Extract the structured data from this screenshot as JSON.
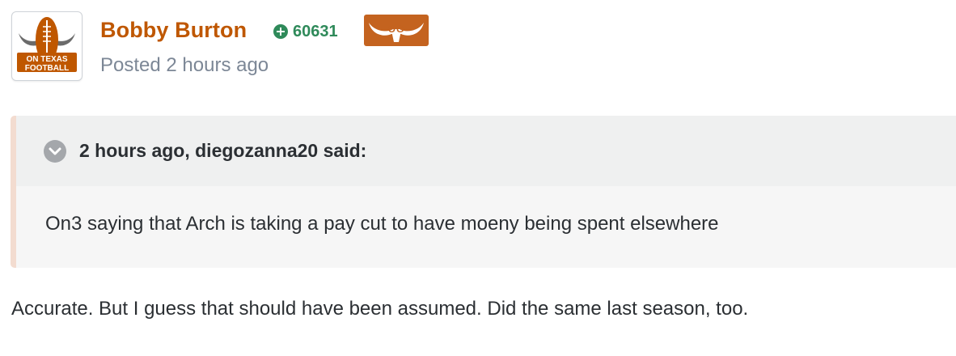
{
  "post": {
    "author": {
      "name": "Bobby Burton",
      "reputation": "60631",
      "badge": "OG",
      "avatar_text_line1": "ON TEXAS",
      "avatar_text_line2": "FOOTBALL"
    },
    "posted_text": "Posted 2 hours ago",
    "quote": {
      "citation": "2 hours ago, diegozanna20 said:",
      "body": "On3 saying that Arch is taking a pay cut to have moeny being spent elsewhere"
    },
    "reply": "Accurate. But I guess that should have been assumed. Did the same last season, too."
  },
  "colors": {
    "author_name": "#bf5700",
    "reputation": "#2f8a5a",
    "badge_bg": "#c4631f",
    "meta_text": "#7c8796",
    "quote_border": "#f3dcd0",
    "quote_head_bg": "#eff0f0",
    "quote_body_bg": "#f6f6f6"
  },
  "icons": {
    "avatar": "on-texas-football-logo",
    "reputation": "plus-circle-icon",
    "badge": "longhorn-og-icon",
    "quote_toggle": "chevron-down-circle-icon"
  }
}
